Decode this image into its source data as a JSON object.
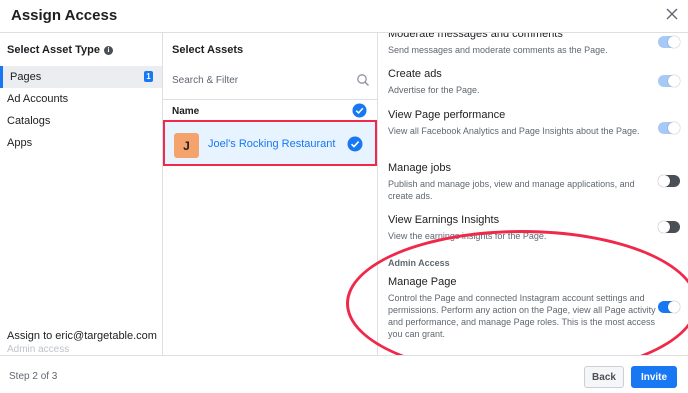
{
  "dialog": {
    "title": "Assign Access"
  },
  "asset_types": {
    "header": "Select Asset Type",
    "items": [
      {
        "label": "Pages",
        "count": "1"
      },
      {
        "label": "Ad Accounts"
      },
      {
        "label": "Catalogs"
      },
      {
        "label": "Apps"
      }
    ],
    "assign_to": "Assign to eric@targetable.com",
    "access_level": "Admin access"
  },
  "assets": {
    "header": "Select Assets",
    "search_placeholder": "Search & Filter",
    "column_name": "Name",
    "rows": [
      {
        "initial": "J",
        "name": "Joel's Rocking Restaurant"
      }
    ]
  },
  "permissions": {
    "items": [
      {
        "title": "Moderate messages and comments",
        "desc": "Send messages and moderate comments as the Page.",
        "state": "on-disabled"
      },
      {
        "title": "Create ads",
        "desc": "Advertise for the Page.",
        "state": "on-disabled"
      },
      {
        "title": "View Page performance",
        "desc": "View all Facebook Analytics and Page Insights about the Page.",
        "state": "on-disabled"
      },
      {
        "title": "Manage jobs",
        "desc": "Publish and manage jobs, view and manage applications, and create ads.",
        "state": "off"
      },
      {
        "title": "View Earnings Insights",
        "desc": "View the earnings insights for the Page.",
        "state": "off"
      }
    ],
    "admin_section_label": "Admin Access",
    "admin_item": {
      "title": "Manage Page",
      "desc": "Control the Page and connected Instagram account settings and permissions. Perform any action on the Page, view all Page activity and performance, and manage Page roles. This is the most access you can grant.",
      "state": "on"
    }
  },
  "footer": {
    "step": "Step 2 of 3",
    "back_label": "Back",
    "invite_label": "Invite"
  },
  "colors": {
    "accent": "#1877f2",
    "annotation": "#f02849"
  }
}
